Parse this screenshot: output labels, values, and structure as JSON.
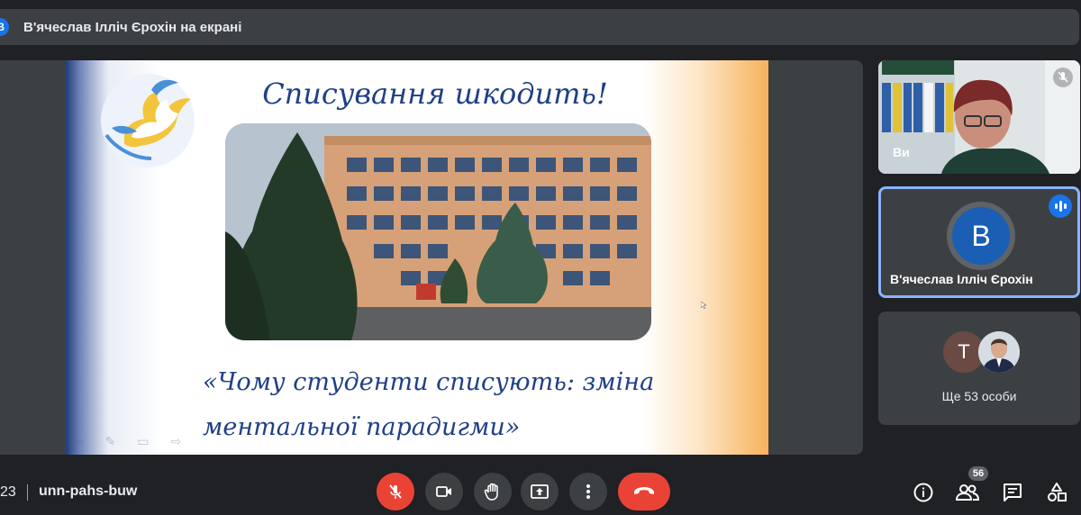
{
  "topbar": {
    "avatar_letter": "В",
    "presenting_title": "В'ячеслав Ілліч Єрохін на екрані"
  },
  "slide": {
    "title": "Списування шкодить!",
    "quote_line1": "«Чому студенти списують: зміна",
    "quote_line2": "ментальної  парадигми»"
  },
  "tiles": {
    "self_label": "Ви",
    "speaker_letter": "В",
    "speaker_name": "В'ячеслав Ілліч Єрохін",
    "others_letter": "Т",
    "others_text": "Ще 53 особи"
  },
  "bottom": {
    "time_fragment": "23",
    "meeting_code": "unn-pahs-buw",
    "participants_count": "56"
  },
  "colors": {
    "accent": "#8ab4f8",
    "danger": "#ea4335",
    "surface": "#3c4043",
    "background": "#202124"
  },
  "icons": [
    "mic-off-icon",
    "camera-icon",
    "raise-hand-icon",
    "present-screen-icon",
    "more-options-icon",
    "hang-up-icon",
    "info-icon",
    "people-icon",
    "chat-icon",
    "activities-icon"
  ]
}
